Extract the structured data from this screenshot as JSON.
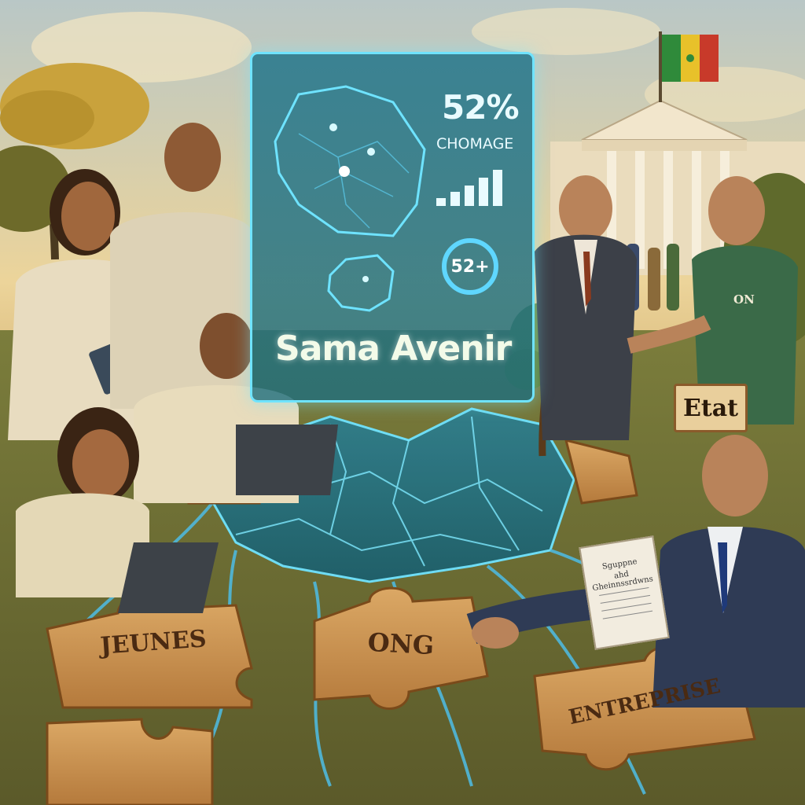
{
  "scene": {
    "stat_percent": "52%",
    "stat_label": "CHOMAGE",
    "badge": "52+",
    "brand": "Sama Avenir",
    "shirt_text": "ON",
    "sign_text": "Etat",
    "doc_line1": "Sguppne",
    "doc_line2": "ahd Gheinnssrdwns",
    "pieces": {
      "jeunes": "JEUNES",
      "ong": "ONG",
      "entreprise": "ENTREPRISE"
    }
  },
  "colors": {
    "hologram": "#6fe3ff",
    "sky": "#e9c98a",
    "grass": "#6f7a3a",
    "puzzle": "#c78a48"
  }
}
